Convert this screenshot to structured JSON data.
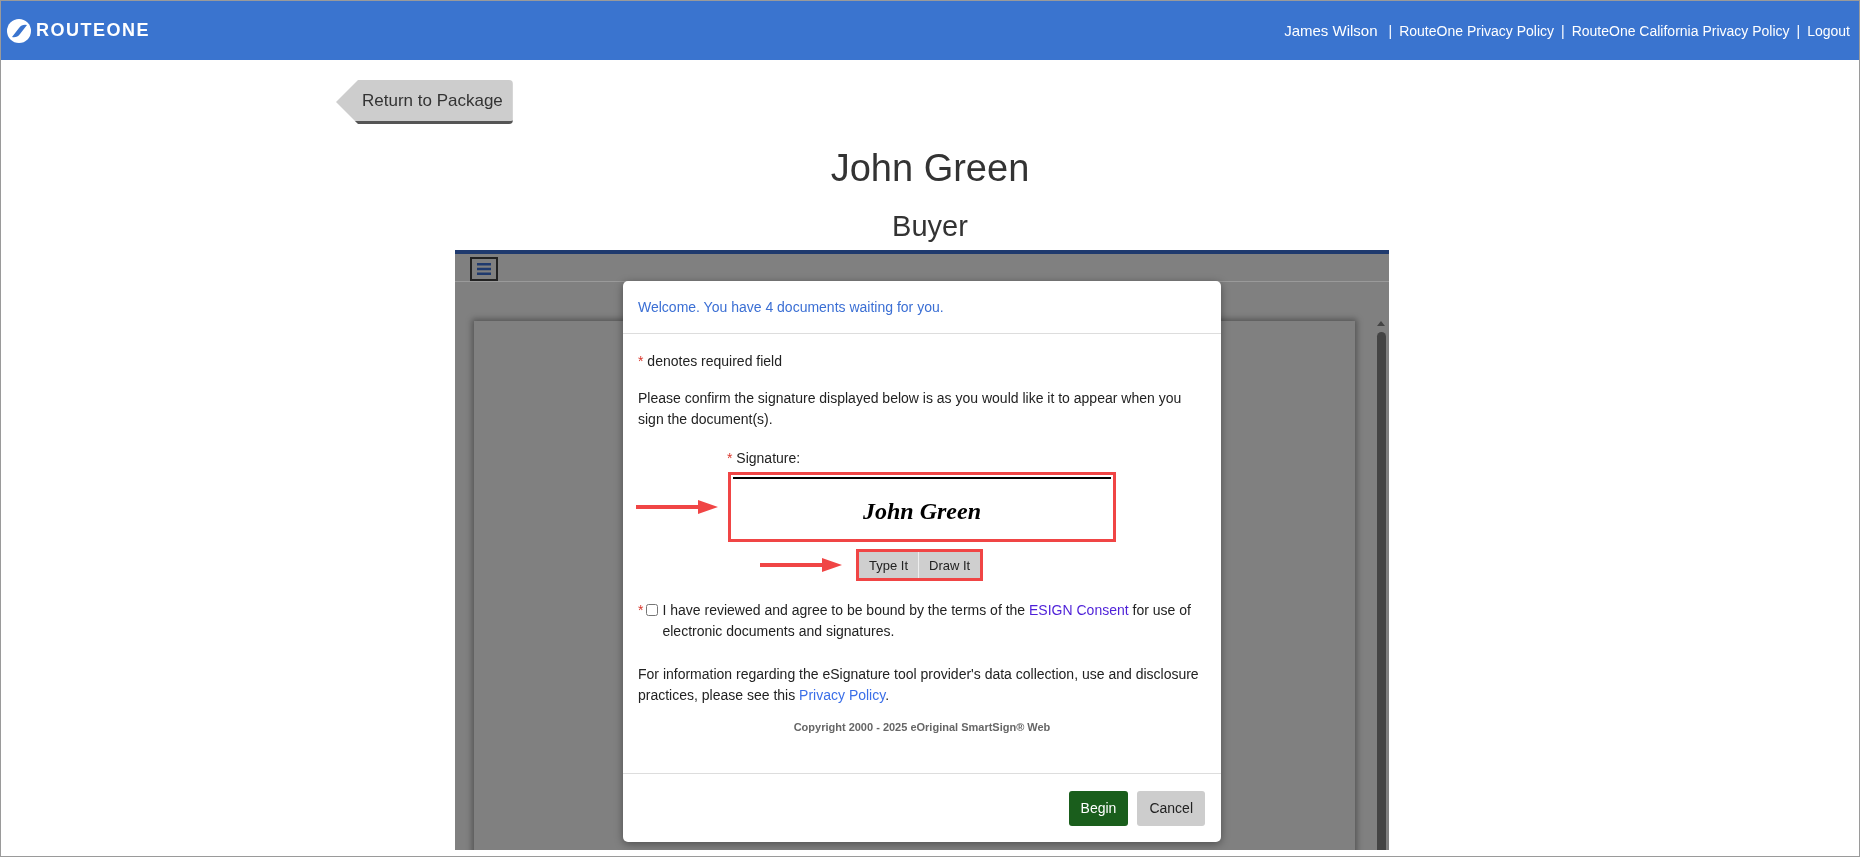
{
  "header": {
    "logo_text": "ROUTEONE",
    "user": "James Wilson",
    "separator": "|",
    "links": [
      "RouteOne Privacy Policy",
      "RouteOne California Privacy Policy",
      "Logout"
    ]
  },
  "back_button": "Return to Package",
  "title": "John Green",
  "subtitle": "Buyer",
  "modal": {
    "welcome": "Welcome. You have 4 documents waiting for you.",
    "required_note": {
      "mark": "*",
      "text": "denotes required field"
    },
    "instructions": "Please confirm the signature displayed below is as you would like it to appear when you sign the document(s).",
    "signature": {
      "mark": "*",
      "label": "Signature:",
      "value": "John Green",
      "modes": [
        "Type It",
        "Draw It"
      ]
    },
    "consent": {
      "mark": "*",
      "checked": false,
      "text_before": "I have reviewed and agree to be bound by the terms of the",
      "link": "ESIGN Consent",
      "text_after": "for use of electronic documents and signatures."
    },
    "privacy": {
      "text_before": "For information regarding the eSignature tool provider's data collection, use and disclosure practices, please see this",
      "link": "Privacy Policy",
      "text_after": "."
    },
    "copyright": "Copyright 2000 - 2025 eOriginal SmartSign® Web",
    "buttons": [
      {
        "label": "Begin",
        "kind": "primary"
      },
      {
        "label": "Cancel",
        "kind": "secondary"
      }
    ]
  }
}
